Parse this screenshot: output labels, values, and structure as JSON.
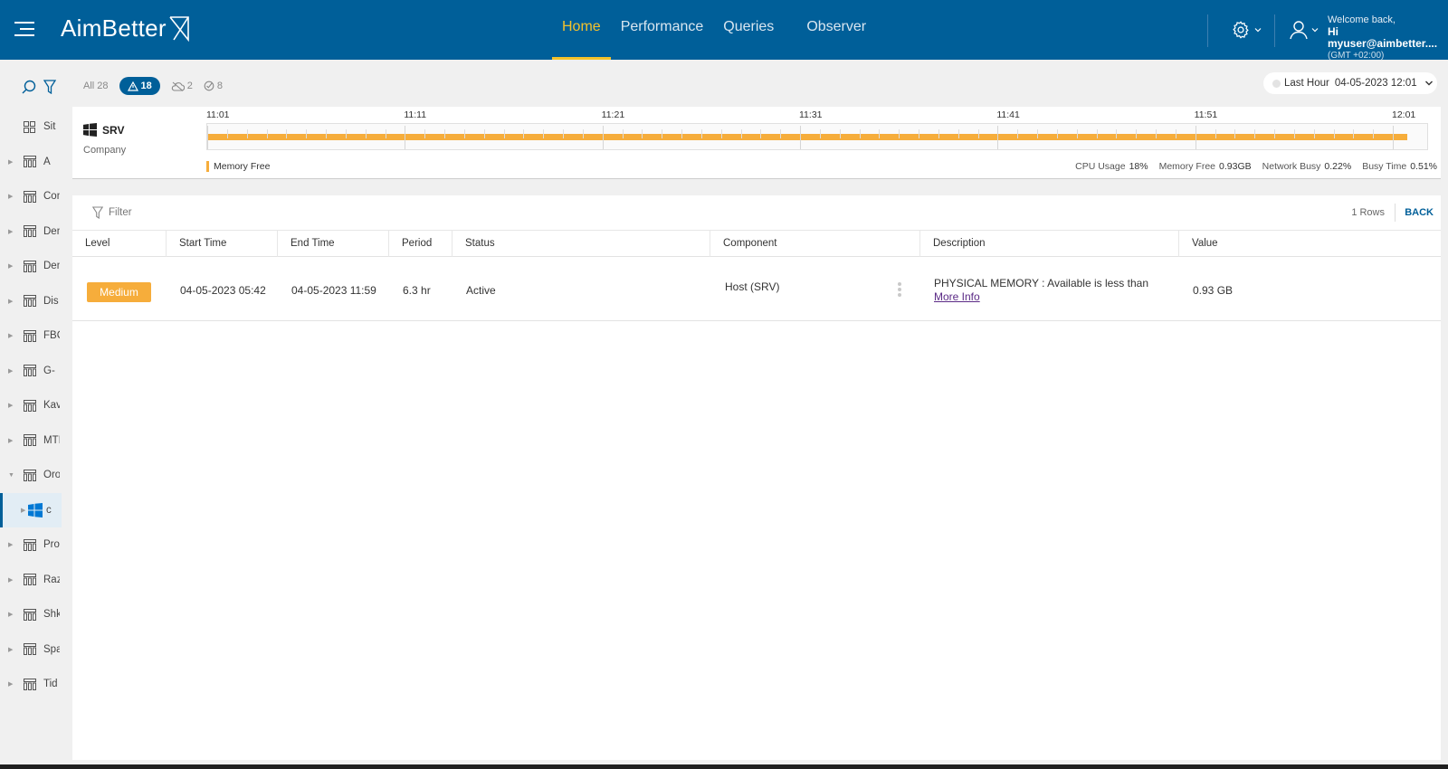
{
  "header": {
    "logo": "AimBetter",
    "nav": [
      {
        "label": "Home",
        "active": true
      },
      {
        "label": "Performance"
      },
      {
        "label": "Queries"
      },
      {
        "label": "Observer"
      }
    ],
    "welcome": "Welcome back,",
    "user": "Hi myuser@aimbetter....",
    "timezone": "(GMT +02:00)",
    "accent_color": "#f4c22b",
    "brand_color": "#005f99"
  },
  "sidebar": {
    "items": [
      {
        "label": "Sit",
        "icon": "sites-grid-icon"
      },
      {
        "label": "A",
        "icon": "company-icon"
      },
      {
        "label": "Con",
        "icon": "company-icon"
      },
      {
        "label": "Den",
        "icon": "company-icon"
      },
      {
        "label": "Den",
        "icon": "company-icon"
      },
      {
        "label": "Dis",
        "icon": "company-icon"
      },
      {
        "label": "FBC",
        "icon": "company-icon"
      },
      {
        "label": "G-",
        "icon": "company-icon"
      },
      {
        "label": "Kav",
        "icon": "company-icon"
      },
      {
        "label": "MTI",
        "icon": "company-icon"
      },
      {
        "label": "Oro",
        "icon": "company-icon",
        "expanded": true
      },
      {
        "label": "c",
        "icon": "windows-icon",
        "selected": true
      },
      {
        "label": "Pro",
        "icon": "company-icon"
      },
      {
        "label": "Raz",
        "icon": "company-icon"
      },
      {
        "label": "Shk",
        "icon": "company-icon"
      },
      {
        "label": "Spa",
        "icon": "company-icon"
      },
      {
        "label": "Tid",
        "icon": "company-icon"
      }
    ]
  },
  "filters": {
    "all": "All 28",
    "alerts": "18",
    "cloud": "2",
    "resolved": "8"
  },
  "timeselector": {
    "range": "Last Hour",
    "datetime": "04-05-2023 12:01"
  },
  "timeline": {
    "server": "SRV",
    "company": "Company",
    "labels": [
      "11:01",
      "11:11",
      "11:21",
      "11:31",
      "11:41",
      "11:51",
      "12:01"
    ],
    "bar_fill": 0.984,
    "legend": "Memory Free",
    "metrics": [
      {
        "label": "CPU Usage",
        "value": "18%"
      },
      {
        "label": "Memory Free",
        "value": "0.93GB"
      },
      {
        "label": "Network Busy",
        "value": "0.22%"
      },
      {
        "label": "Busy Time",
        "value": "0.51%"
      }
    ]
  },
  "table": {
    "filter_placeholder": "Filter",
    "rows_count": "1 Rows",
    "back": "BACK",
    "columns": [
      "Level",
      "Start Time",
      "End Time",
      "Period",
      "Status",
      "Component",
      "Description",
      "Value"
    ],
    "rows": [
      {
        "level": "Medium",
        "start": "04-05-2023 05:42",
        "end": "04-05-2023 11:59",
        "period": "6.3 hr",
        "status": "Active",
        "component": "Host (SRV)",
        "description": "PHYSICAL MEMORY : Available is less than",
        "more_info": "More Info",
        "value": "0.93 GB"
      }
    ]
  }
}
